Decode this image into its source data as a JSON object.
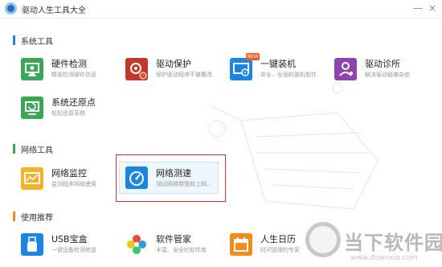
{
  "window": {
    "title": "驱动人生工具大全",
    "minimize_symbol": "—",
    "close_symbol": "×"
  },
  "sections": [
    {
      "label": "系统工具",
      "accent_color": "#1a86e0"
    },
    {
      "label": "网络工具",
      "accent_color": "#3aa757"
    },
    {
      "label": "使用推荐",
      "accent_color": "#f08c1a"
    }
  ],
  "tools": {
    "hardware_check": {
      "name": "硬件检测",
      "desc": "精准检测硬件信息",
      "icon": "monitor-icon",
      "color": "#3aa757"
    },
    "driver_protect": {
      "name": "驱动保护",
      "desc": "保护驱动程序不被篡改",
      "icon": "shield-gear-icon",
      "color": "#c0392b"
    },
    "one_click_install": {
      "name": "一键装机",
      "desc": "安全、全面的装机软件",
      "icon": "computer-disc-icon",
      "color": "#1a86e0",
      "badge": "NEW"
    },
    "driver_diagnose": {
      "name": "驱动诊所",
      "desc": "解决驱动疑难杂症",
      "icon": "doctor-icon",
      "color": "#8e44ad"
    },
    "system_restore": {
      "name": "系统还原点",
      "desc": "轻松还原系统",
      "icon": "restore-monitor-icon",
      "color": "#3aa757"
    },
    "network_monitor": {
      "name": "网络监控",
      "desc": "监测程序网络使用",
      "icon": "network-chart-icon",
      "color": "#f0b429"
    },
    "network_speed": {
      "name": "网络测速",
      "desc": "测试网络带宽和上网...",
      "icon": "speedometer-icon",
      "color": "#1a86e0"
    },
    "usb_box": {
      "name": "USB宝盒",
      "desc": "一键设备检测修复",
      "icon": "usb-icon",
      "color": "#1a86e0"
    },
    "software_manager": {
      "name": "软件管家",
      "desc": "丰富、安全的软件库",
      "icon": "flower-icon",
      "color": "#e74c3c"
    },
    "life_calendar": {
      "name": "人生日历",
      "desc": "时间管理的专家",
      "icon": "calendar-icon",
      "color": "#f08c1a"
    }
  },
  "watermark": {
    "text": "当下软件园",
    "domain": "www.downxia.com"
  }
}
